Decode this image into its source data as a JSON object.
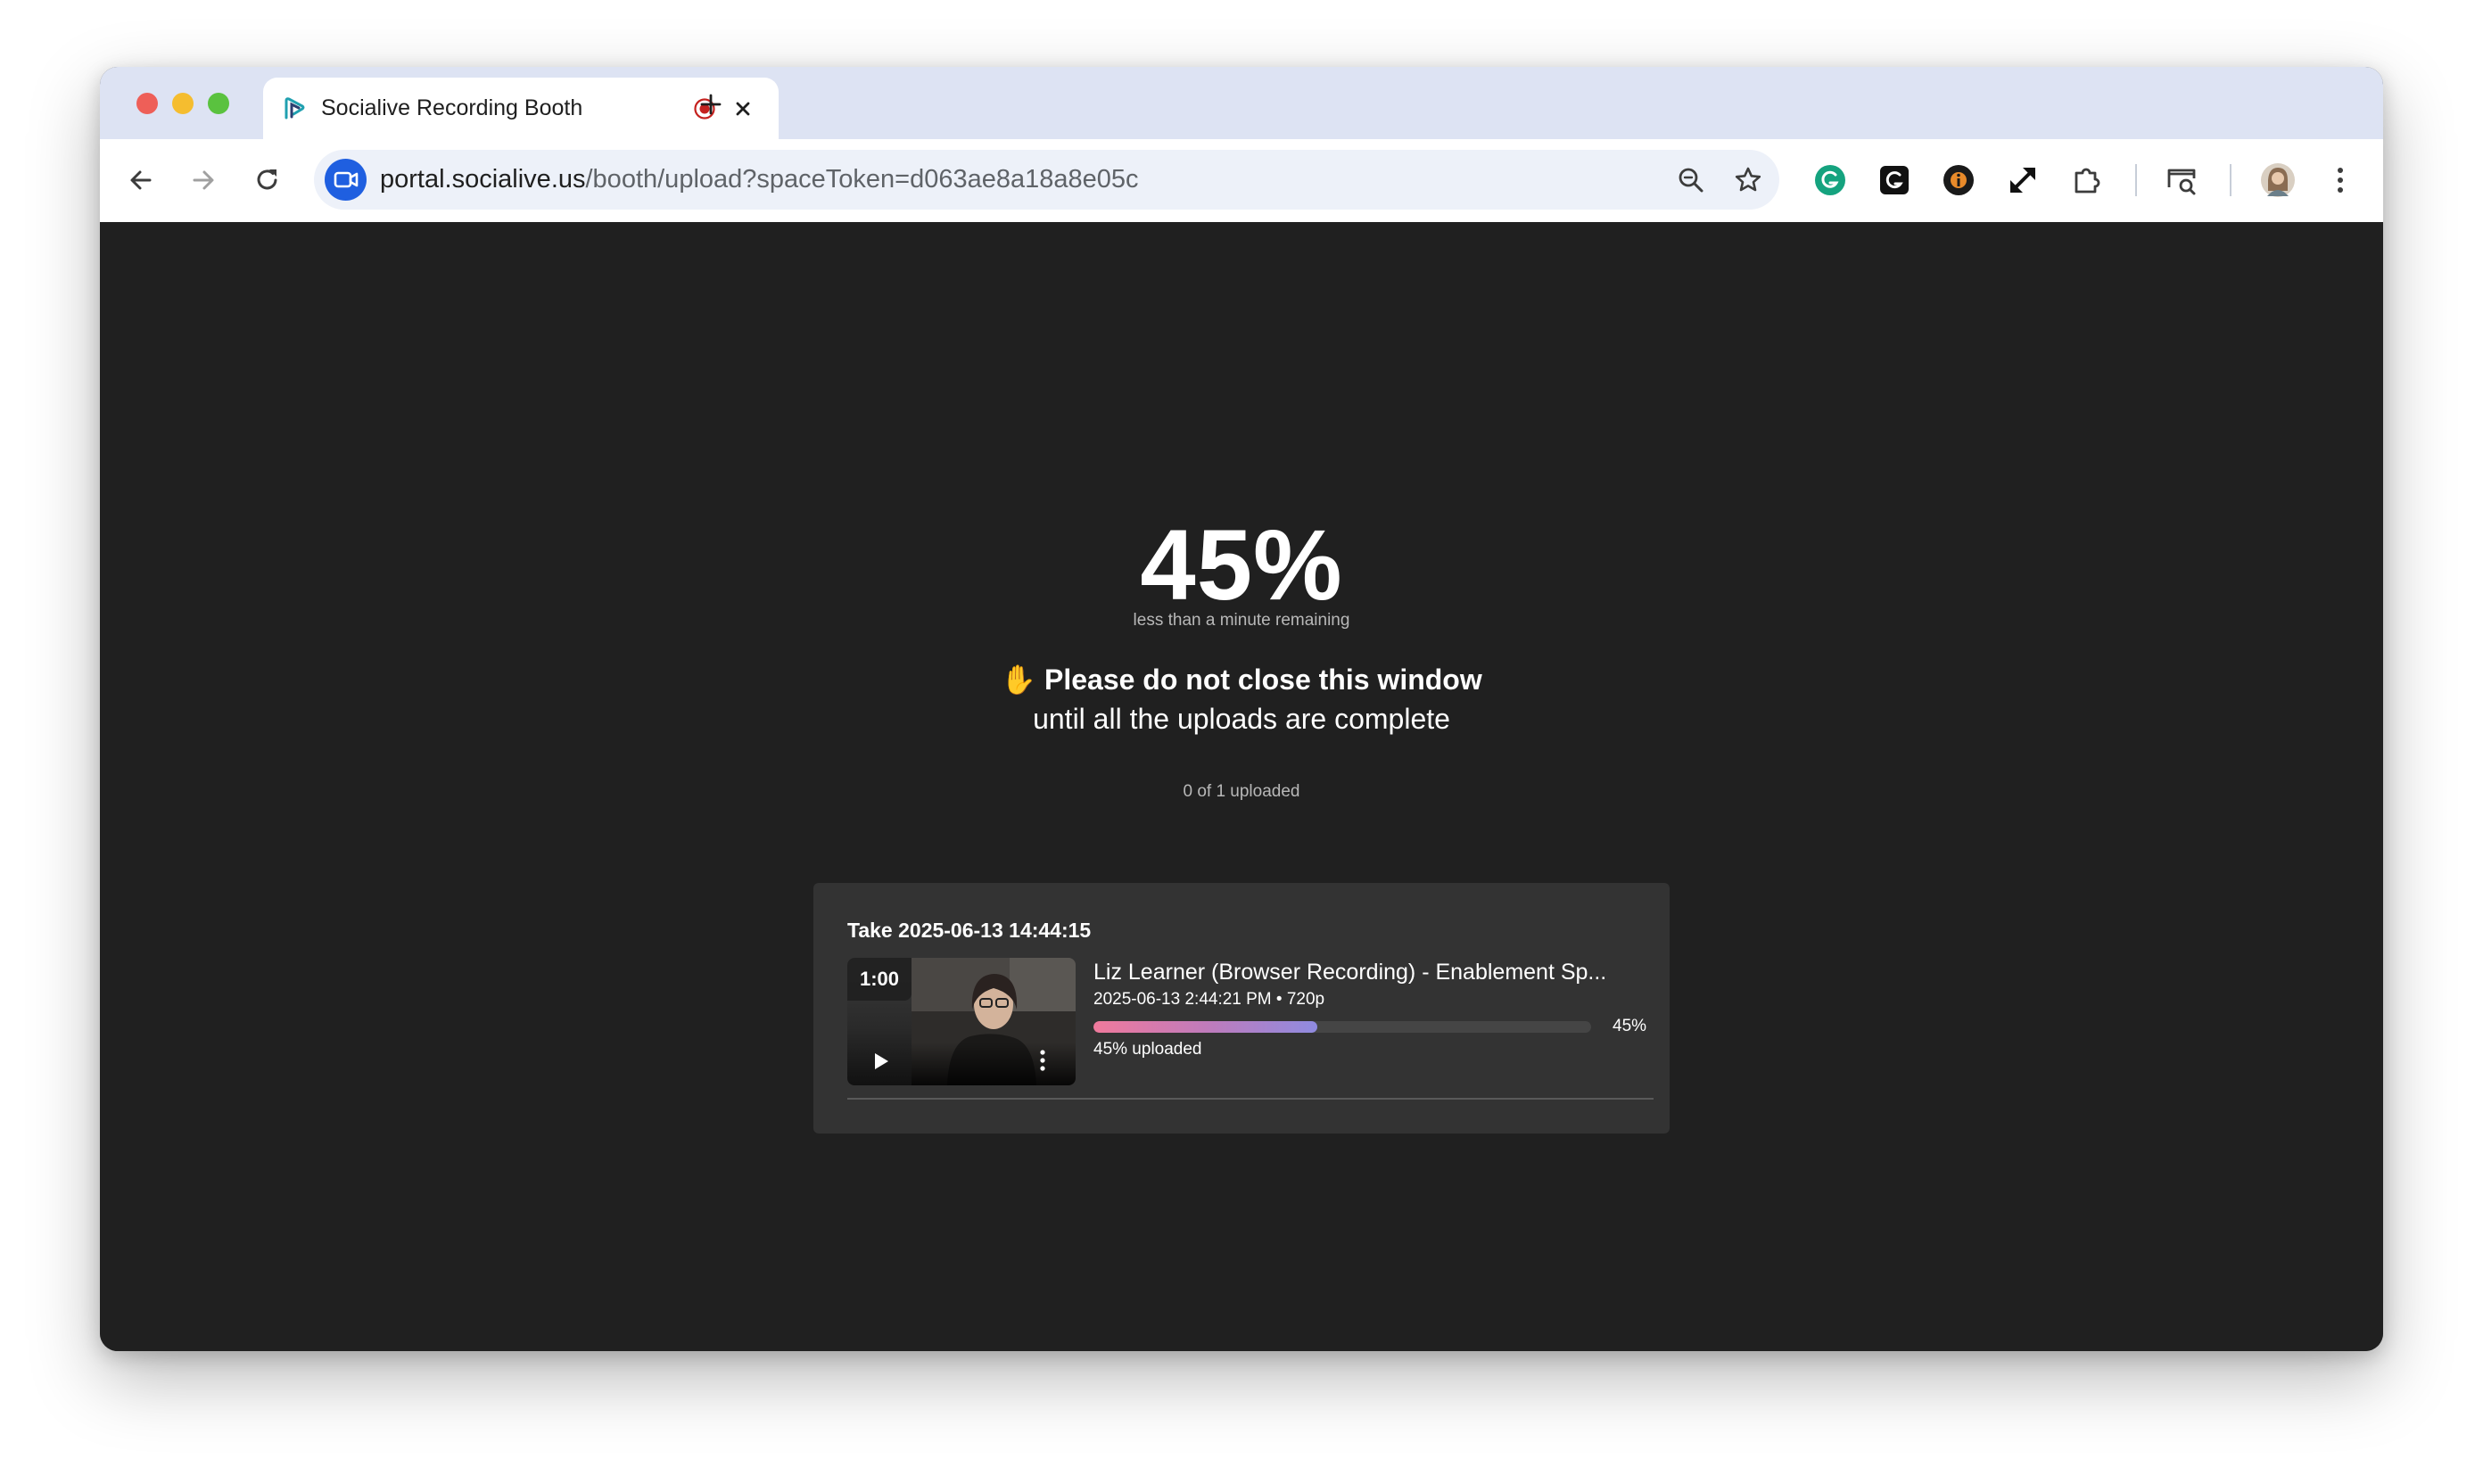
{
  "browser": {
    "tab_title": "Socialive Recording Booth",
    "url_host": "portal.socialive.us",
    "url_path": "/booth/upload?spaceToken=d063ae8a18a8e05c",
    "icons": {
      "back": "arrow-left-icon",
      "forward": "arrow-right-icon",
      "reload": "reload-icon",
      "zoom": "zoom-icon",
      "bookmark": "star-icon",
      "extensions": [
        "grammarly-icon",
        "grammar-check-icon",
        "info-extension-icon",
        "expand-icon",
        "puzzle-icon",
        "tab-search-icon"
      ],
      "menu": "kebab-menu-icon"
    }
  },
  "upload": {
    "percent": "45%",
    "remaining": "less than a minute remaining",
    "warning_bold": "✋ Please do not close this window",
    "warning_rest": "until all the uploads are complete",
    "count": "0 of 1 uploaded"
  },
  "take": {
    "title": "Take 2025-06-13 14:44:15",
    "recording": {
      "duration": "1:00",
      "title": "Liz Learner (Browser Recording) - Enablement Sp...",
      "meta": "2025-06-13 2:44:21 PM • 720p",
      "progress": 0.45,
      "progress_label": "45%",
      "status": "45% uploaded"
    }
  },
  "colors": {
    "page_bg": "#202020",
    "card_bg": "#333333",
    "progress_start": "#f07a9c",
    "progress_end": "#8f8be0",
    "tabstrip": "#dde3f3"
  }
}
